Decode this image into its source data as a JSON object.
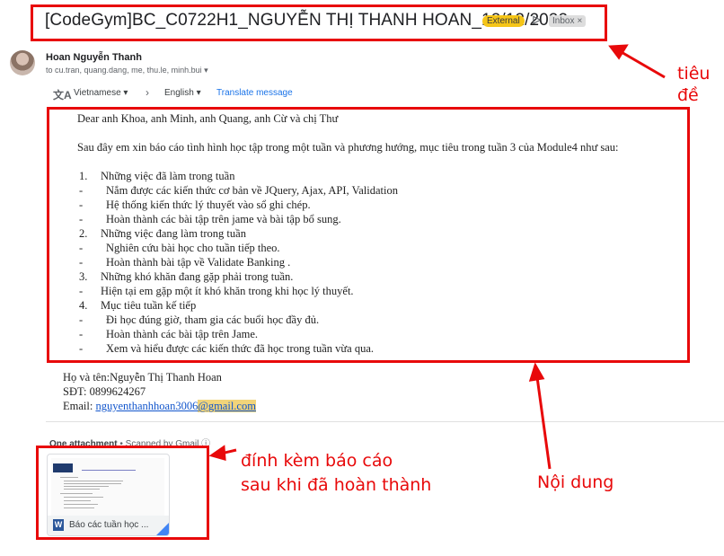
{
  "email": {
    "subject": "[CodeGym]BC_C0722H1_NGUYỄN THỊ THANH HOAN_12/12/2022",
    "labels": {
      "external": "External",
      "inbox": "Inbox",
      "inbox_close": "×"
    },
    "importance_icon": "label-marker-icon",
    "sender": {
      "name": "Hoan Nguyễn Thanh",
      "recipients": "to cu.tran, quang.dang, me, thu.le, minh.bui",
      "recipients_caret": "▾"
    }
  },
  "translate_bar": {
    "icon": "translate-icon",
    "from_lang": "Vietnamese ▾",
    "arrow": "›",
    "to_lang": "English ▾",
    "link": "Translate message"
  },
  "body": {
    "greeting": "Dear anh Khoa, anh Minh, anh Quang, anh Cừ  và chị Thư",
    "intro": "Sau đây em xin báo cáo tình hình học tập trong một tuần và phương hướng, mục tiêu trong tuần 3 của Module4 như sau:",
    "s1_num": "1.",
    "s1_title": "Những việc đã làm trong tuần",
    "s1_i1": "Nắm được các kiến thức cơ bản về JQuery, Ajax, API, Validation",
    "s1_i2": "Hệ thống kiến thức lý thuyết vào sổ ghi chép.",
    "s1_i3": "Hoàn thành các bài tập trên jame và bài tập bổ sung.",
    "s2_num": "2.",
    "s2_title": "Những việc đang làm trong tuần",
    "s2_i1": "Nghiên cứu bài học cho tuần tiếp theo.",
    "s2_i2": "Hoàn thành bài tập về Validate Banking .",
    "s3_num": "3.",
    "s3_title": "Những khó khăn đang gặp phải trong tuần.",
    "s3_i1": "Hiện tại em gặp một ít khó khăn trong khi học lý thuyết.",
    "s4_num": "4.",
    "s4_title": "Mục tiêu tuần kế tiếp",
    "s4_i1": "Đi học đúng giờ, tham gia các buổi học đầy đủ.",
    "s4_i2": "Hoàn thành các bài tập trên Jame.",
    "s4_i3": "Xem và hiểu được các kiến thức đã học trong tuần vừa qua.",
    "dash": "-"
  },
  "signature": {
    "name_line": "Họ và tên:Nguyễn Thị Thanh Hoan",
    "phone_line": "SĐT: 0899624267",
    "email_label": "Email: ",
    "email_user": "nguyenthanhhoan3006",
    "email_domain": "@gmail.com"
  },
  "attachment": {
    "header_count": "One attachment",
    "header_sep": "•",
    "header_scan": "Scanned by Gmail",
    "file_name": "Báo các tuần học ...",
    "file_icon": "word-doc-icon",
    "file_icon_letter": "W"
  },
  "annotations": {
    "title_note": "tiêu\nđề",
    "title_note_line1": "tiêu",
    "title_note_line2": "đề",
    "content_note": "Nội dung",
    "attach_note_line1": "đính kèm báo cáo",
    "attach_note_line2": "sau khi đã hoàn thành",
    "color": "#e8090a"
  }
}
